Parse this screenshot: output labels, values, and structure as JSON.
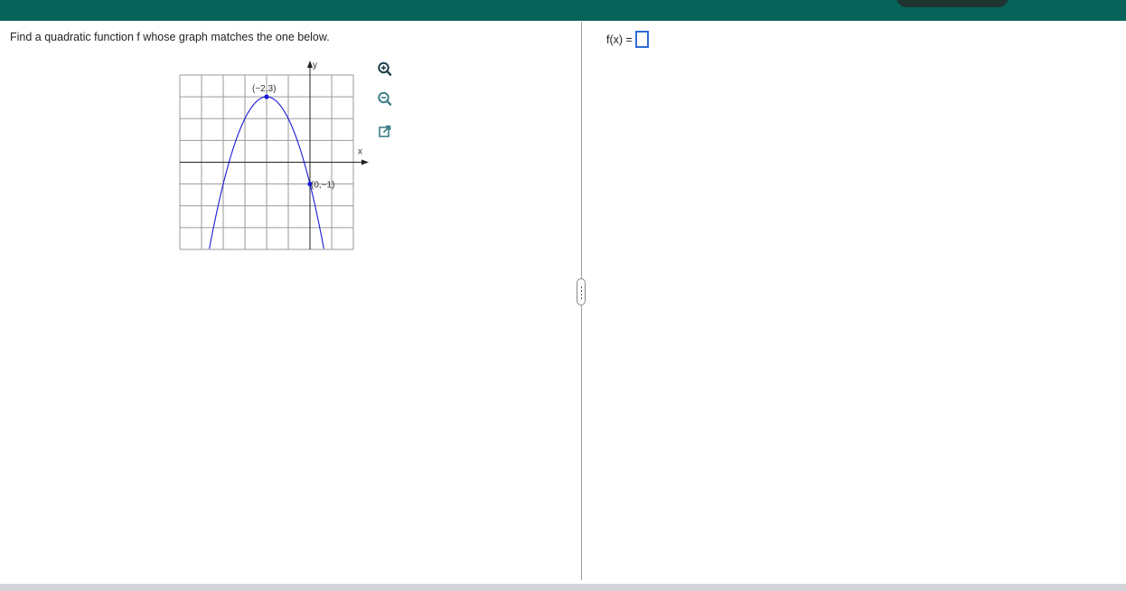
{
  "header": {
    "color": "#06635a"
  },
  "question": {
    "text": "Find a quadratic function f whose graph matches the one below."
  },
  "graph": {
    "axis_labels": {
      "x": "x",
      "y": "y"
    },
    "curve_color": "#1a1ad6",
    "points": [
      {
        "label": "(−2,3)",
        "x": -2,
        "y": 3
      },
      {
        "label": "(0,−1)",
        "x": 0,
        "y": -1
      }
    ],
    "x_range": [
      -6,
      2
    ],
    "y_range": [
      -4,
      4
    ]
  },
  "tools": {
    "zoom_in": "magnifier-plus-icon",
    "zoom_out": "magnifier-minus-icon",
    "popout": "popout-icon"
  },
  "answer": {
    "label": "f(x) =",
    "value": ""
  }
}
